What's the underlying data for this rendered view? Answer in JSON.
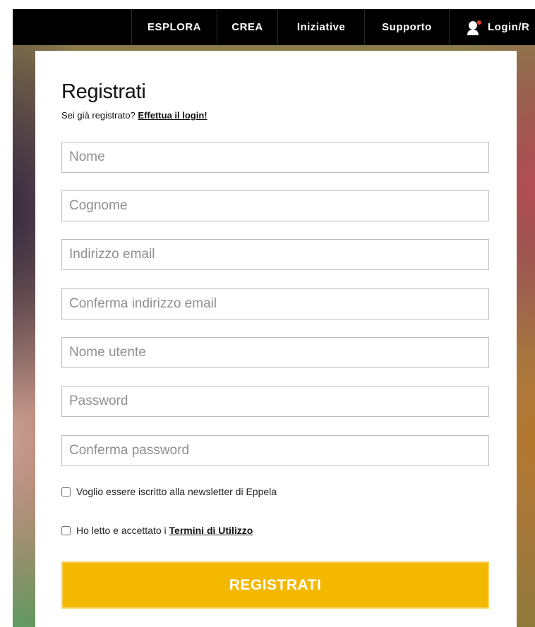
{
  "nav": {
    "items": [
      "ESPLORA",
      "CREA",
      "Iniziative",
      "Supporto"
    ],
    "login_label": "Login/R",
    "login_icon": "user-icon"
  },
  "form": {
    "title": "Registrati",
    "subtitle_text": "Sei già registrato? ",
    "subtitle_link": "Effettua il login!",
    "fields": {
      "first_name": {
        "placeholder": "Nome",
        "value": ""
      },
      "last_name": {
        "placeholder": "Cognome",
        "value": ""
      },
      "email": {
        "placeholder": "Indirizzo email",
        "value": ""
      },
      "email_confirm": {
        "placeholder": "Conferma indirizzo email",
        "value": ""
      },
      "username": {
        "placeholder": "Nome utente",
        "value": ""
      },
      "password": {
        "placeholder": "Password",
        "value": ""
      },
      "password_confirm": {
        "placeholder": "Conferma password",
        "value": ""
      }
    },
    "newsletter_label": "Voglio essere iscritto alla newsletter di Eppela",
    "terms_prefix": "Ho letto e accettato i ",
    "terms_link": "Termini di Utilizzo",
    "submit_label": "REGISTRATI"
  },
  "colors": {
    "nav_bg": "#000000",
    "button_bg": "#f4b800",
    "notification_dot": "#e8412c"
  }
}
